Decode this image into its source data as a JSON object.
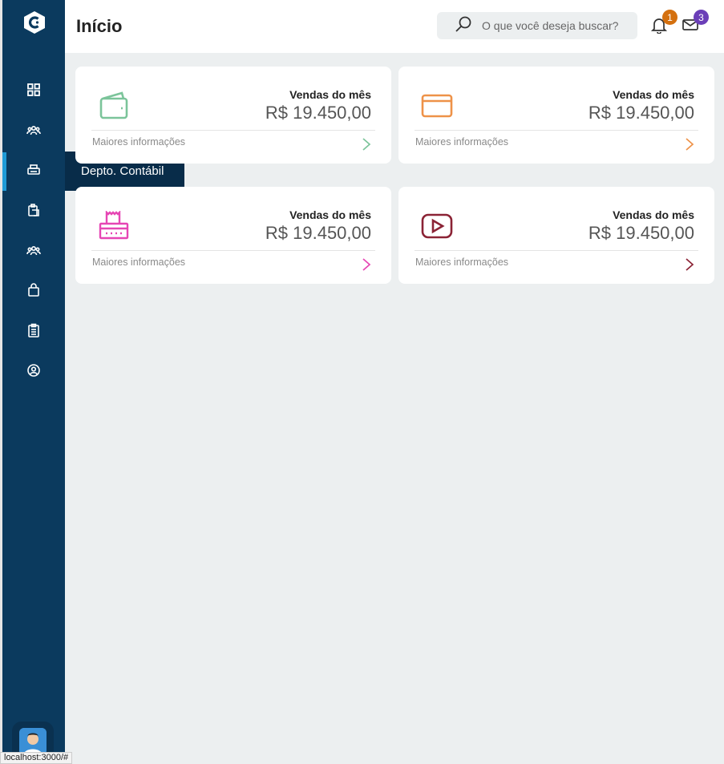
{
  "app": {
    "logo_icon": "c-logo-icon"
  },
  "header": {
    "title": "Início",
    "search_placeholder": "O que você deseja buscar?",
    "notifications_count": "1",
    "messages_count": "3"
  },
  "sidebar": {
    "items": [
      {
        "name": "dashboard",
        "icon": "grid-icon"
      },
      {
        "name": "team",
        "icon": "users-icon"
      },
      {
        "name": "depto-contabil",
        "icon": "printer-icon",
        "active": true
      },
      {
        "name": "documents",
        "icon": "clipboard-copy-icon"
      },
      {
        "name": "groups",
        "icon": "users-icon"
      },
      {
        "name": "shopping",
        "icon": "shopping-bag-icon"
      },
      {
        "name": "reports",
        "icon": "clipboard-list-icon"
      },
      {
        "name": "profile",
        "icon": "user-circle-icon"
      }
    ],
    "tooltip": "Depto. Contábil"
  },
  "cards": [
    {
      "title": "Vendas do mês",
      "value": "R$ 19.450,00",
      "link": "Maiores informações",
      "icon": "wallet-icon",
      "color": "#7bc49a"
    },
    {
      "title": "Vendas do mês",
      "value": "R$ 19.450,00",
      "link": "Maiores informações",
      "icon": "credit-card-icon",
      "color": "#ee9248"
    },
    {
      "title": "Vendas do mês",
      "value": "R$ 19.450,00",
      "link": "Maiores informações",
      "icon": "receipt-printer-icon",
      "color": "#e646b4"
    },
    {
      "title": "Vendas do mês",
      "value": "R$ 19.450,00",
      "link": "Maiores informações",
      "icon": "video-play-icon",
      "color": "#8b2335"
    }
  ],
  "statusbar": {
    "url": "localhost:3000/#"
  },
  "colors": {
    "sidebar": "#0b3a5e",
    "accent": "#1f9bd7",
    "notification_badge": "#d4700f",
    "message_badge": "#6b3fb8"
  }
}
